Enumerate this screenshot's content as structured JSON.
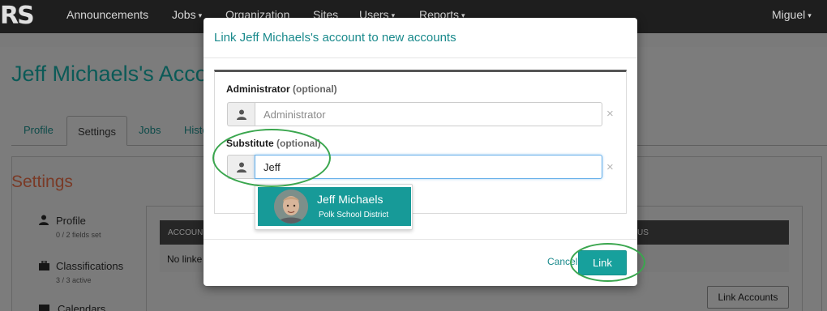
{
  "app": {
    "logo": "RS",
    "nav": {
      "items": [
        {
          "label": "Announcements",
          "dropdown": false
        },
        {
          "label": "Jobs",
          "dropdown": true
        },
        {
          "label": "Organization",
          "dropdown": false
        },
        {
          "label": "Sites",
          "dropdown": false
        },
        {
          "label": "Users",
          "dropdown": true
        },
        {
          "label": "Reports",
          "dropdown": true
        }
      ],
      "user": "Miguel",
      "caret": "▾"
    }
  },
  "page": {
    "title": "Jeff Michaels's Acco",
    "tabs": [
      "Profile",
      "Settings",
      "Jobs",
      "Histo"
    ],
    "active_tab": "Settings",
    "settings_heading": "Settings",
    "side_links": [
      {
        "label": "Profile",
        "sub": "0 / 2 fields set",
        "icon": "user-icon"
      },
      {
        "label": "Classifications",
        "sub": "3 / 3 active",
        "icon": "briefcase-icon"
      },
      {
        "label": "Calendars",
        "sub": "",
        "icon": "calendar-icon"
      }
    ],
    "table": {
      "header_left": "ACCOUN",
      "header_right": "US",
      "empty_text": "No linke"
    },
    "link_accounts_button": "Link Accounts"
  },
  "modal": {
    "title": "Link Jeff Michaels's account to new accounts",
    "administrator": {
      "label": "Administrator",
      "optional": "(optional)",
      "placeholder": "Administrator",
      "value": ""
    },
    "substitute": {
      "label": "Substitute",
      "optional": "(optional)",
      "placeholder": "",
      "value": "Jeff"
    },
    "clear_glyph": "×",
    "suggestions": [
      {
        "name": "Jeff Michaels",
        "organization": "Polk School District"
      }
    ],
    "cancel_label": "Cancel",
    "link_label": "Link"
  },
  "colors": {
    "accent": "#1a8a8c",
    "highlight": "#179a98",
    "annotation": "#3aa64e"
  }
}
